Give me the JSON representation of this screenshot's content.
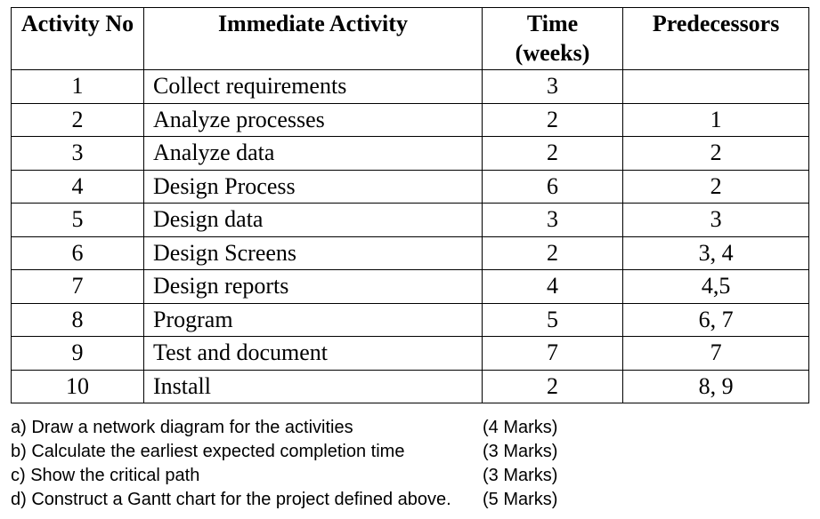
{
  "table": {
    "headers": {
      "no": "Activity No",
      "activity": "Immediate Activity",
      "time": "Time (weeks)",
      "pred": "Predecessors"
    },
    "rows": [
      {
        "no": "1",
        "activity": "Collect requirements",
        "time": "3",
        "pred": ""
      },
      {
        "no": "2",
        "activity": "Analyze processes",
        "time": "2",
        "pred": "1"
      },
      {
        "no": "3",
        "activity": "Analyze data",
        "time": "2",
        "pred": "2"
      },
      {
        "no": "4",
        "activity": "Design Process",
        "time": "6",
        "pred": "2"
      },
      {
        "no": "5",
        "activity": "Design data",
        "time": "3",
        "pred": "3"
      },
      {
        "no": "6",
        "activity": "Design Screens",
        "time": "2",
        "pred": "3, 4"
      },
      {
        "no": "7",
        "activity": "Design reports",
        "time": "4",
        "pred": "4,5"
      },
      {
        "no": "8",
        "activity": "Program",
        "time": "5",
        "pred": "6, 7"
      },
      {
        "no": "9",
        "activity": "Test and document",
        "time": "7",
        "pred": "7"
      },
      {
        "no": "10",
        "activity": "Install",
        "time": "2",
        "pred": "8, 9"
      }
    ]
  },
  "questions": [
    {
      "text": "a) Draw a network diagram for the activities",
      "marks": "(4 Marks)"
    },
    {
      "text": "b) Calculate the earliest expected completion time",
      "marks": "(3 Marks)"
    },
    {
      "text": "c) Show the critical path",
      "marks": "(3 Marks)"
    },
    {
      "text": "d) Construct a Gantt chart for the project defined above.",
      "marks": "(5 Marks)"
    }
  ]
}
